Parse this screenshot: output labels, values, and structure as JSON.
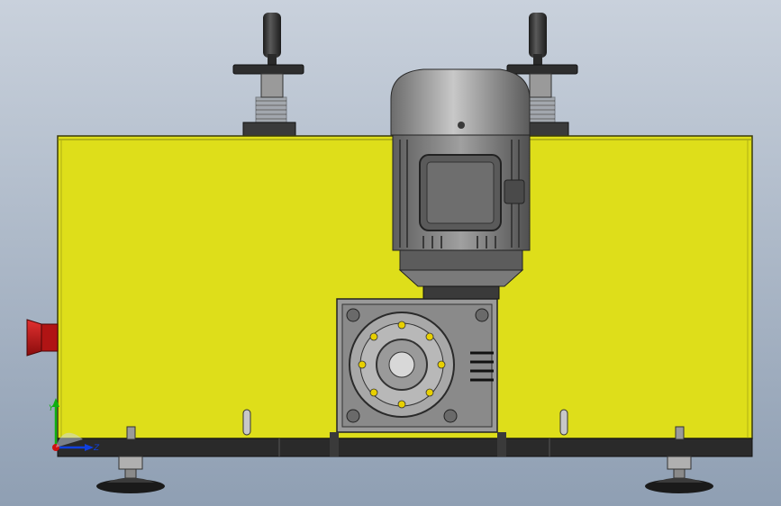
{
  "view": {
    "background_top": "#c9d1dc",
    "background_bottom": "#8f9fb3"
  },
  "colors": {
    "housing": "#dede1a",
    "housing_edge": "#3a3a0a",
    "motor": "#8e8e8e",
    "motor_dark": "#3c3c3c",
    "gearbox": "#9a9a9a",
    "base": "#2a2a2a",
    "emergency_button": "#c01818",
    "bolt_accent": "#e8d000"
  },
  "triad": {
    "y_label": "Y",
    "z_label": "Z",
    "x_color": "#d01010",
    "y_color": "#10b010",
    "z_color": "#1040e0"
  },
  "components": [
    {
      "name": "yellow-housing"
    },
    {
      "name": "electric-motor"
    },
    {
      "name": "worm-gearbox"
    },
    {
      "name": "handwheel-left"
    },
    {
      "name": "handwheel-right"
    },
    {
      "name": "emergency-stop-button"
    },
    {
      "name": "leveling-foot-left"
    },
    {
      "name": "leveling-foot-right"
    },
    {
      "name": "base-frame"
    }
  ]
}
